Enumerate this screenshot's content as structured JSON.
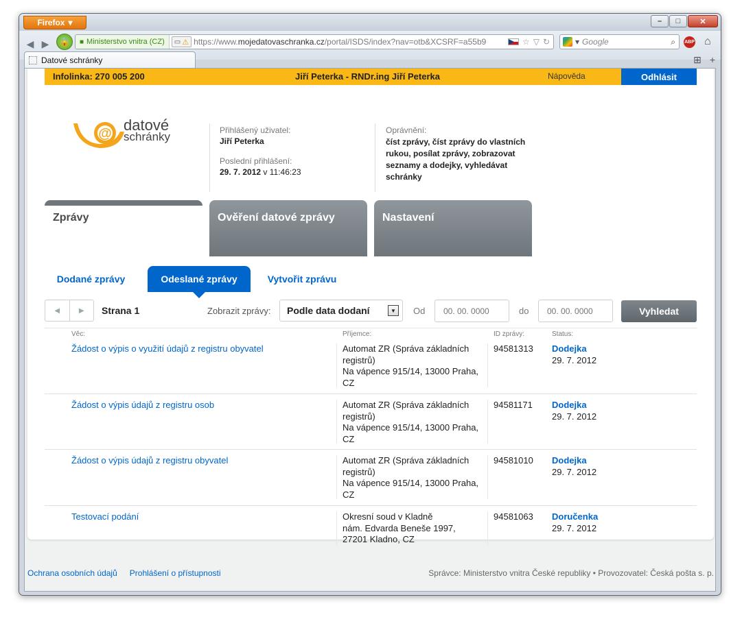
{
  "browser": {
    "menu_label": "Firefox",
    "tab_title": "Datové schránky",
    "identity": "Ministerstvo vnitra (CZ)",
    "url_prefix": "https://www.",
    "url_domain": "mojedatovaschranka.cz",
    "url_rest": "/portal/ISDS/index?nav=otb&XCSRF=a55b9",
    "search_placeholder": "Google",
    "abp_label": "ABP"
  },
  "topbar": {
    "infoline": "Infolinka: 270 005 200",
    "user": "Jiří Peterka - RNDr.ing Jiří Peterka",
    "help": "Nápověda",
    "logout": "Odhlásit"
  },
  "logo": {
    "line1": "datové",
    "line2": "schránky"
  },
  "account": {
    "logged_user_label": "Přihlášený uživatel:",
    "logged_user": "Jiří Peterka",
    "last_login_label": "Poslední přihlášení:",
    "last_login_date": "29. 7. 2012",
    "last_login_time": " v 11:46:23",
    "permissions_label": "Oprávnění:",
    "permissions": "číst zprávy, číst zprávy do vlastních rukou, posílat zprávy, zobrazovat seznamy a dodejky, vyhledávat schránky"
  },
  "main_tabs": [
    "Zprávy",
    "Ověření datové zprávy",
    "Nastavení"
  ],
  "sub_tabs": [
    "Dodané zprávy",
    "Odeslané zprávy",
    "Vytvořit zprávu"
  ],
  "filter": {
    "page": "Strana 1",
    "show_label": "Zobrazit zprávy:",
    "show_value": "Podle data dodaní",
    "from_label": "Od",
    "to_label": "do",
    "date_placeholder": "00. 00. 0000",
    "search_button": "Vyhledat"
  },
  "table": {
    "headers": {
      "subject": "Věc:",
      "recipient": "Příjemce:",
      "id": "ID zprávy:",
      "status": "Status:"
    },
    "rows": [
      {
        "subject": "Žádost o výpis o využití údajů z registru obyvatel",
        "recipient": "Automat ZR (Správa základních registrů)",
        "address": "Na vápence 915/14, 13000 Praha, CZ",
        "id": "94581313",
        "status": "Dodejka",
        "date": "29. 7. 2012"
      },
      {
        "subject": "Žádost o výpis údajů z registru osob",
        "recipient": "Automat ZR (Správa základních registrů)",
        "address": "Na vápence 915/14, 13000 Praha, CZ",
        "id": "94581171",
        "status": "Dodejka",
        "date": "29. 7. 2012"
      },
      {
        "subject": "Žádost o výpis údajů z registru obyvatel",
        "recipient": "Automat ZR (Správa základních registrů)",
        "address": "Na vápence 915/14, 13000 Praha, CZ",
        "id": "94581010",
        "status": "Dodejka",
        "date": "29. 7. 2012"
      },
      {
        "subject": "Testovací podání",
        "recipient": "Okresní soud v Kladně",
        "address": "nám. Edvarda Beneše 1997, 27201 Kladno, CZ",
        "id": "94581063",
        "status": "Doručenka",
        "date": "29. 7. 2012"
      }
    ]
  },
  "footer": {
    "link1": "Ochrana osobních údajů",
    "link2": "Prohlášení o přístupnosti",
    "right": "Správce: Ministerstvo vnitra České republiky • Provozovatel: Česká pošta s. p."
  },
  "colors": {
    "accent_orange": "#f9b815",
    "link_blue": "#0066cc",
    "tab_gray": "#6e757b"
  }
}
